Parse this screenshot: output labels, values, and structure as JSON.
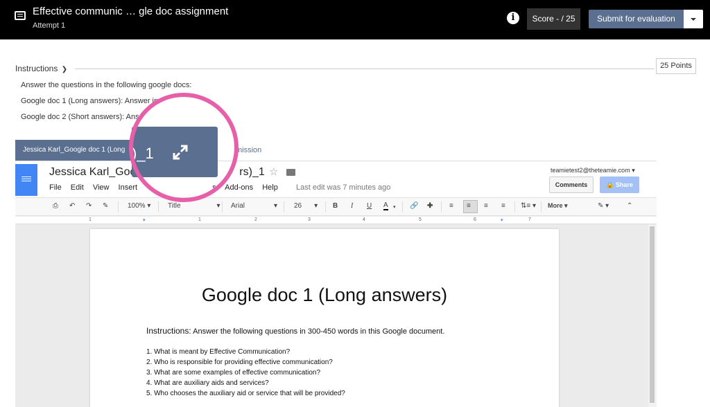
{
  "header": {
    "title": "Effective communic … gle doc assignment",
    "attempt": "Attempt 1",
    "score": "Score - / 25",
    "submit": "Submit for evaluation"
  },
  "instructions": {
    "label": "Instructions",
    "points": "25 Points",
    "lines": [
      "Answer the questions in the following google docs:",
      "Google doc 1 (Long answers): Answer in",
      "Google doc 2 (Short answers): Ans"
    ]
  },
  "tabs": {
    "active": "Jessica Karl_Google doc 1 (Long",
    "submission": "mission"
  },
  "expand_popup": {
    "text": ")_1"
  },
  "gdoc": {
    "title_left": "Jessica Karl_Goog",
    "title_right": "rs)_1",
    "menu": [
      "File",
      "Edit",
      "View",
      "Insert",
      "",
      "s",
      "Add-ons",
      "Help"
    ],
    "last_edit": "Last edit was 7 minutes ago",
    "email": "teamietest2@theteamie.com",
    "comments": "Comments",
    "share": "Share",
    "toolbar": {
      "zoom": "100%",
      "style": "Title",
      "font": "Arial",
      "size": "26",
      "more": "More"
    },
    "ruler": [
      "1",
      "1",
      "1",
      "2",
      "3",
      "4",
      "5",
      "6",
      "7"
    ]
  },
  "page": {
    "title": "Google doc 1 (Long answers)",
    "instructions_label": "Instructions:",
    "instructions_text": "Answer the following questions in 300-450 words in this Google document.",
    "questions": [
      "1. What is meant by Effective Communication?",
      "2. Who is responsible for providing effective communication?",
      "3. What are some examples of effective communication?",
      "4. What are auxiliary aids and services?",
      "5. Who chooses the auxiliary aid or service that will be provided?"
    ]
  }
}
